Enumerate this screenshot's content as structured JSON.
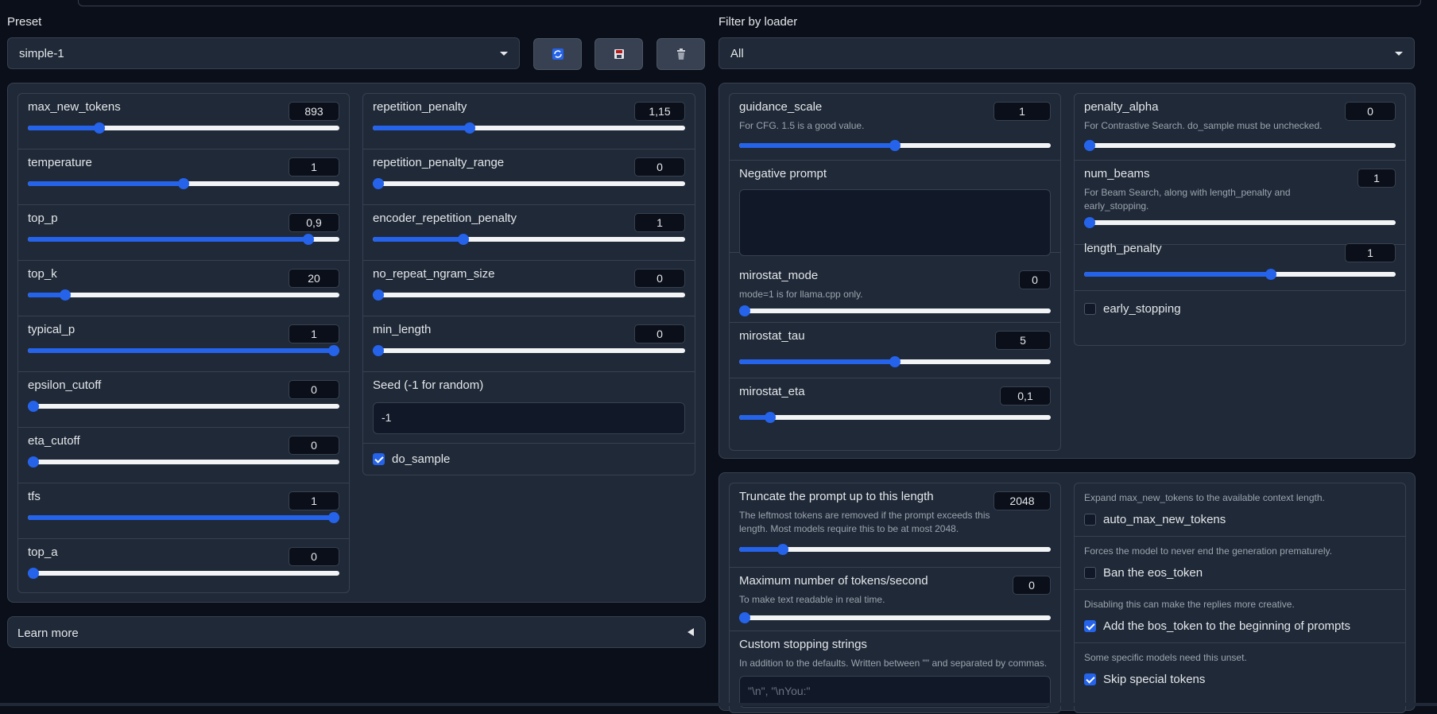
{
  "top": {
    "preset_label": "Preset",
    "preset_value": "simple-1",
    "filter_label": "Filter by loader",
    "filter_value": "All",
    "icons": [
      "refresh-icon",
      "save-icon",
      "trash-icon"
    ]
  },
  "left": {
    "colA": [
      {
        "label": "max_new_tokens",
        "value": "893",
        "pct": 0.23
      },
      {
        "label": "temperature",
        "value": "1",
        "pct": 0.5
      },
      {
        "label": "top_p",
        "value": "0,9",
        "pct": 0.9
      },
      {
        "label": "top_k",
        "value": "20",
        "pct": 0.12
      },
      {
        "label": "typical_p",
        "value": "1",
        "pct": 1.0
      },
      {
        "label": "epsilon_cutoff",
        "value": "0",
        "pct": 0.0
      },
      {
        "label": "eta_cutoff",
        "value": "0",
        "pct": 0.0
      },
      {
        "label": "tfs",
        "value": "1",
        "pct": 1.0
      },
      {
        "label": "top_a",
        "value": "0",
        "pct": 0.0
      }
    ],
    "colB": [
      {
        "label": "repetition_penalty",
        "value": "1,15",
        "pct": 0.31
      },
      {
        "label": "repetition_penalty_range",
        "value": "0",
        "pct": 0.0
      },
      {
        "label": "encoder_repetition_penalty",
        "value": "1",
        "pct": 0.29
      },
      {
        "label": "no_repeat_ngram_size",
        "value": "0",
        "pct": 0.0
      },
      {
        "label": "min_length",
        "value": "0",
        "pct": 0.0
      }
    ],
    "seed_label": "Seed (-1 for random)",
    "seed_value": "-1",
    "do_sample_label": "do_sample",
    "do_sample_checked": true,
    "learn_more": "Learn more"
  },
  "right_top": {
    "guidance_scale": {
      "label": "guidance_scale",
      "info": "For CFG. 1.5 is a good value.",
      "value": "1",
      "pct": 0.5
    },
    "negative_prompt_label": "Negative prompt",
    "mirostat_mode": {
      "label": "mirostat_mode",
      "info": "mode=1 is for llama.cpp only.",
      "value": "0",
      "pct": 0.0
    },
    "mirostat_tau": {
      "label": "mirostat_tau",
      "value": "5",
      "pct": 0.5
    },
    "mirostat_eta": {
      "label": "mirostat_eta",
      "value": "0,1",
      "pct": 0.1
    },
    "penalty_alpha": {
      "label": "penalty_alpha",
      "info": "For Contrastive Search. do_sample must be unchecked.",
      "value": "0",
      "pct": 0.0
    },
    "num_beams": {
      "label": "num_beams",
      "info_line1": "For Beam Search, along with length_penalty and",
      "info_line2": "early_stopping.",
      "value": "1",
      "pct": 0.0
    },
    "length_penalty": {
      "label": "length_penalty",
      "value": "1",
      "pct": 0.6
    },
    "early_stopping_label": "early_stopping"
  },
  "right_bottom": {
    "truncate": {
      "label": "Truncate the prompt up to this length",
      "info_line1": "The leftmost tokens are removed if the prompt exceeds this",
      "info_line2": "length. Most models require this to be at most 2048.",
      "value": "2048",
      "pct": 0.14
    },
    "max_tps": {
      "label": "Maximum number of tokens/second",
      "info": "To make text readable in real time.",
      "value": "0",
      "pct": 0.0
    },
    "stopping": {
      "label": "Custom stopping strings",
      "info": "In addition to the defaults. Written between \"\" and separated by commas.",
      "placeholder": "\"\\n\", \"\\nYou:\""
    },
    "auto_max": {
      "info": "Expand max_new_tokens to the available context length.",
      "label": "auto_max_new_tokens",
      "checked": false
    },
    "ban_eos": {
      "info": "Forces the model to never end the generation prematurely.",
      "label": "Ban the eos_token",
      "checked": false
    },
    "add_bos": {
      "info": "Disabling this can make the replies more creative.",
      "label": "Add the bos_token to the beginning of prompts",
      "checked": true
    },
    "skip_special": {
      "info": "Some specific models need this unset.",
      "label": "Skip special tokens",
      "checked": true
    }
  },
  "colors": {
    "accent": "#2563eb",
    "panel": "#1f2937",
    "bg": "#0b0f19"
  }
}
